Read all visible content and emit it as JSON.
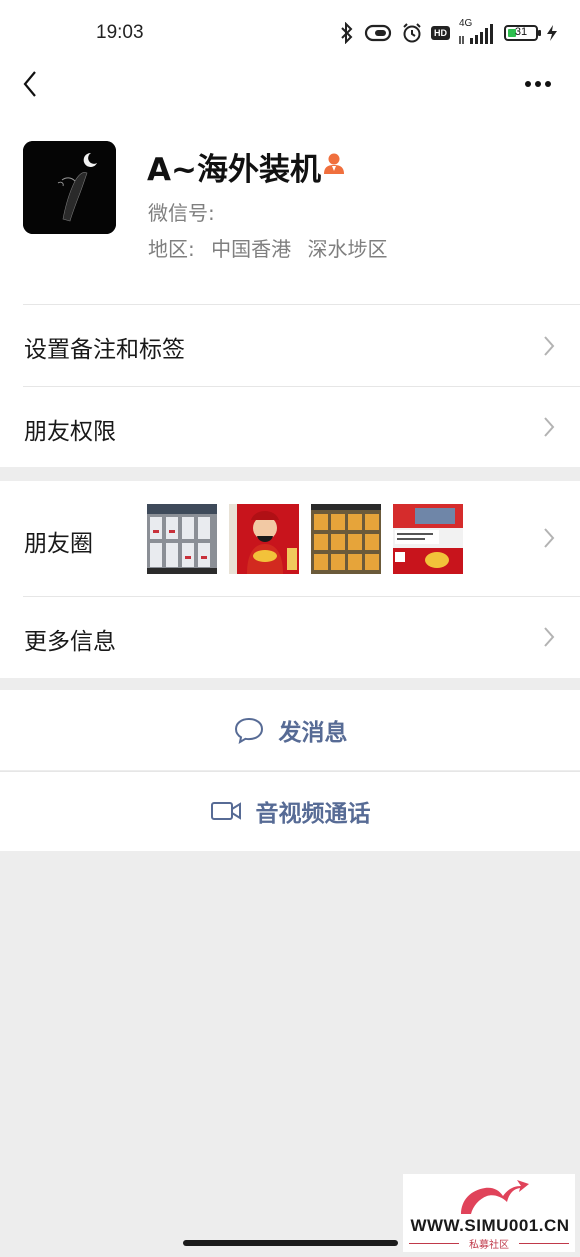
{
  "status_bar": {
    "time": "19:03",
    "network_label": "4G",
    "hd_label": "HD",
    "battery_percent": 31
  },
  "nav": {
    "back_icon": "chevron-left-icon",
    "more_icon": "ellipsis-icon"
  },
  "profile": {
    "name": "A~海外装机",
    "wechat_id_label": "微信号:",
    "region": "地区:  中国香港  深水埗区"
  },
  "menu": {
    "remark_tags": "设置备注和标签",
    "friend_permissions": "朋友权限",
    "moments": "朋友圈",
    "more_info": "更多信息"
  },
  "actions": {
    "send_message": "发消息",
    "video_call": "音视频通话"
  },
  "watermark": {
    "text": "WWW.SIMU001.CN",
    "subtitle": "私募社区"
  },
  "colors": {
    "link_blue": "#576b95",
    "page_bg": "#ededed",
    "badge_orange": "#f06f3d"
  }
}
